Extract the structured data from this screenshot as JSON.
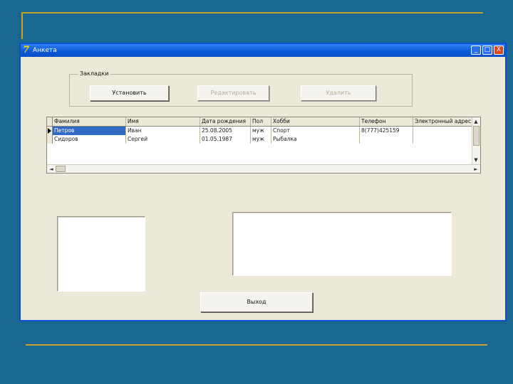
{
  "window": {
    "title": "Анкета",
    "title_icon": "7",
    "minimize": "_",
    "maximize": "□",
    "close": "X"
  },
  "group": {
    "legend": "Закладки",
    "buttons": [
      {
        "label": "Установить",
        "enabled": true
      },
      {
        "label": "Редактировать",
        "enabled": false
      },
      {
        "label": "Удалить",
        "enabled": false
      }
    ]
  },
  "grid": {
    "columns": [
      "Фамилия",
      "Имя",
      "Дата рождения",
      "Пол",
      "Хобби",
      "Телефон",
      "Электронный адрес"
    ],
    "rows": [
      [
        "Петров",
        "Иван",
        "25.08.2005",
        "муж",
        "Спорт",
        "8(777)425159",
        ""
      ],
      [
        "Сидоров",
        "Сергей",
        "01.05.1987",
        "муж",
        "Рыбалка",
        "",
        ""
      ]
    ],
    "selected_row": 0,
    "icons": {
      "row_indicator": "row-pointer-icon",
      "scroll_up": "▲",
      "scroll_down": "▼",
      "scroll_left": "◄",
      "scroll_right": "►"
    }
  },
  "exit_button": {
    "label": "Выход"
  },
  "colors": {
    "background": "#1a6791",
    "accent_line": "#c9a227",
    "titlebar": "#0a58d8",
    "selection": "#316ac5"
  }
}
